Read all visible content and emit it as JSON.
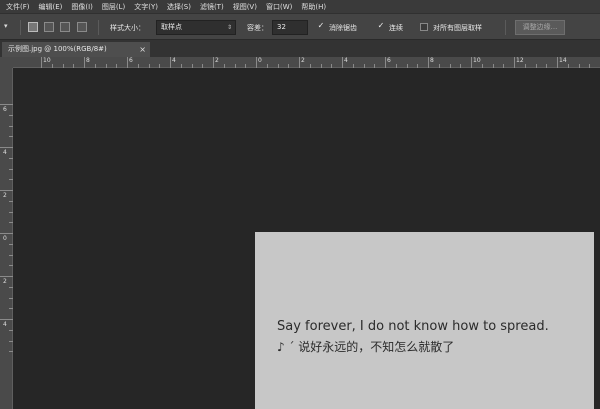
{
  "menu": [
    "文件(F)",
    "编辑(E)",
    "图像(I)",
    "图层(L)",
    "文字(Y)",
    "选择(S)",
    "滤镜(T)",
    "视图(V)",
    "窗口(W)",
    "帮助(H)"
  ],
  "options": {
    "style_label": "样式大小：",
    "style_value": "取样点",
    "tolerance_label": "容差：",
    "tolerance_value": "32",
    "anti_alias_label": "消除锯齿",
    "contiguous_label": "连续",
    "sample_all_label": "对所有图层取样",
    "refine_edge_label": "调整边缘..."
  },
  "tab": {
    "title": "示例图.jpg @ 100%(RGB/8#)",
    "close": "×"
  },
  "ruler": {
    "h_labels": [
      "10",
      "8",
      "6",
      "4",
      "2",
      "0",
      "2",
      "4",
      "6",
      "8",
      "10",
      "12",
      "14"
    ],
    "v_labels": [
      "6",
      "4",
      "2",
      "0",
      "2",
      "4"
    ]
  },
  "canvas": {
    "line1": "Say forever, I do not know how to spread.",
    "line2": "♪ ˊ 说好永远的，不知怎么就散了"
  },
  "colors": {
    "ui_dark": "#262626",
    "panel": "#444444",
    "image_bg": "#c7c7c7"
  }
}
